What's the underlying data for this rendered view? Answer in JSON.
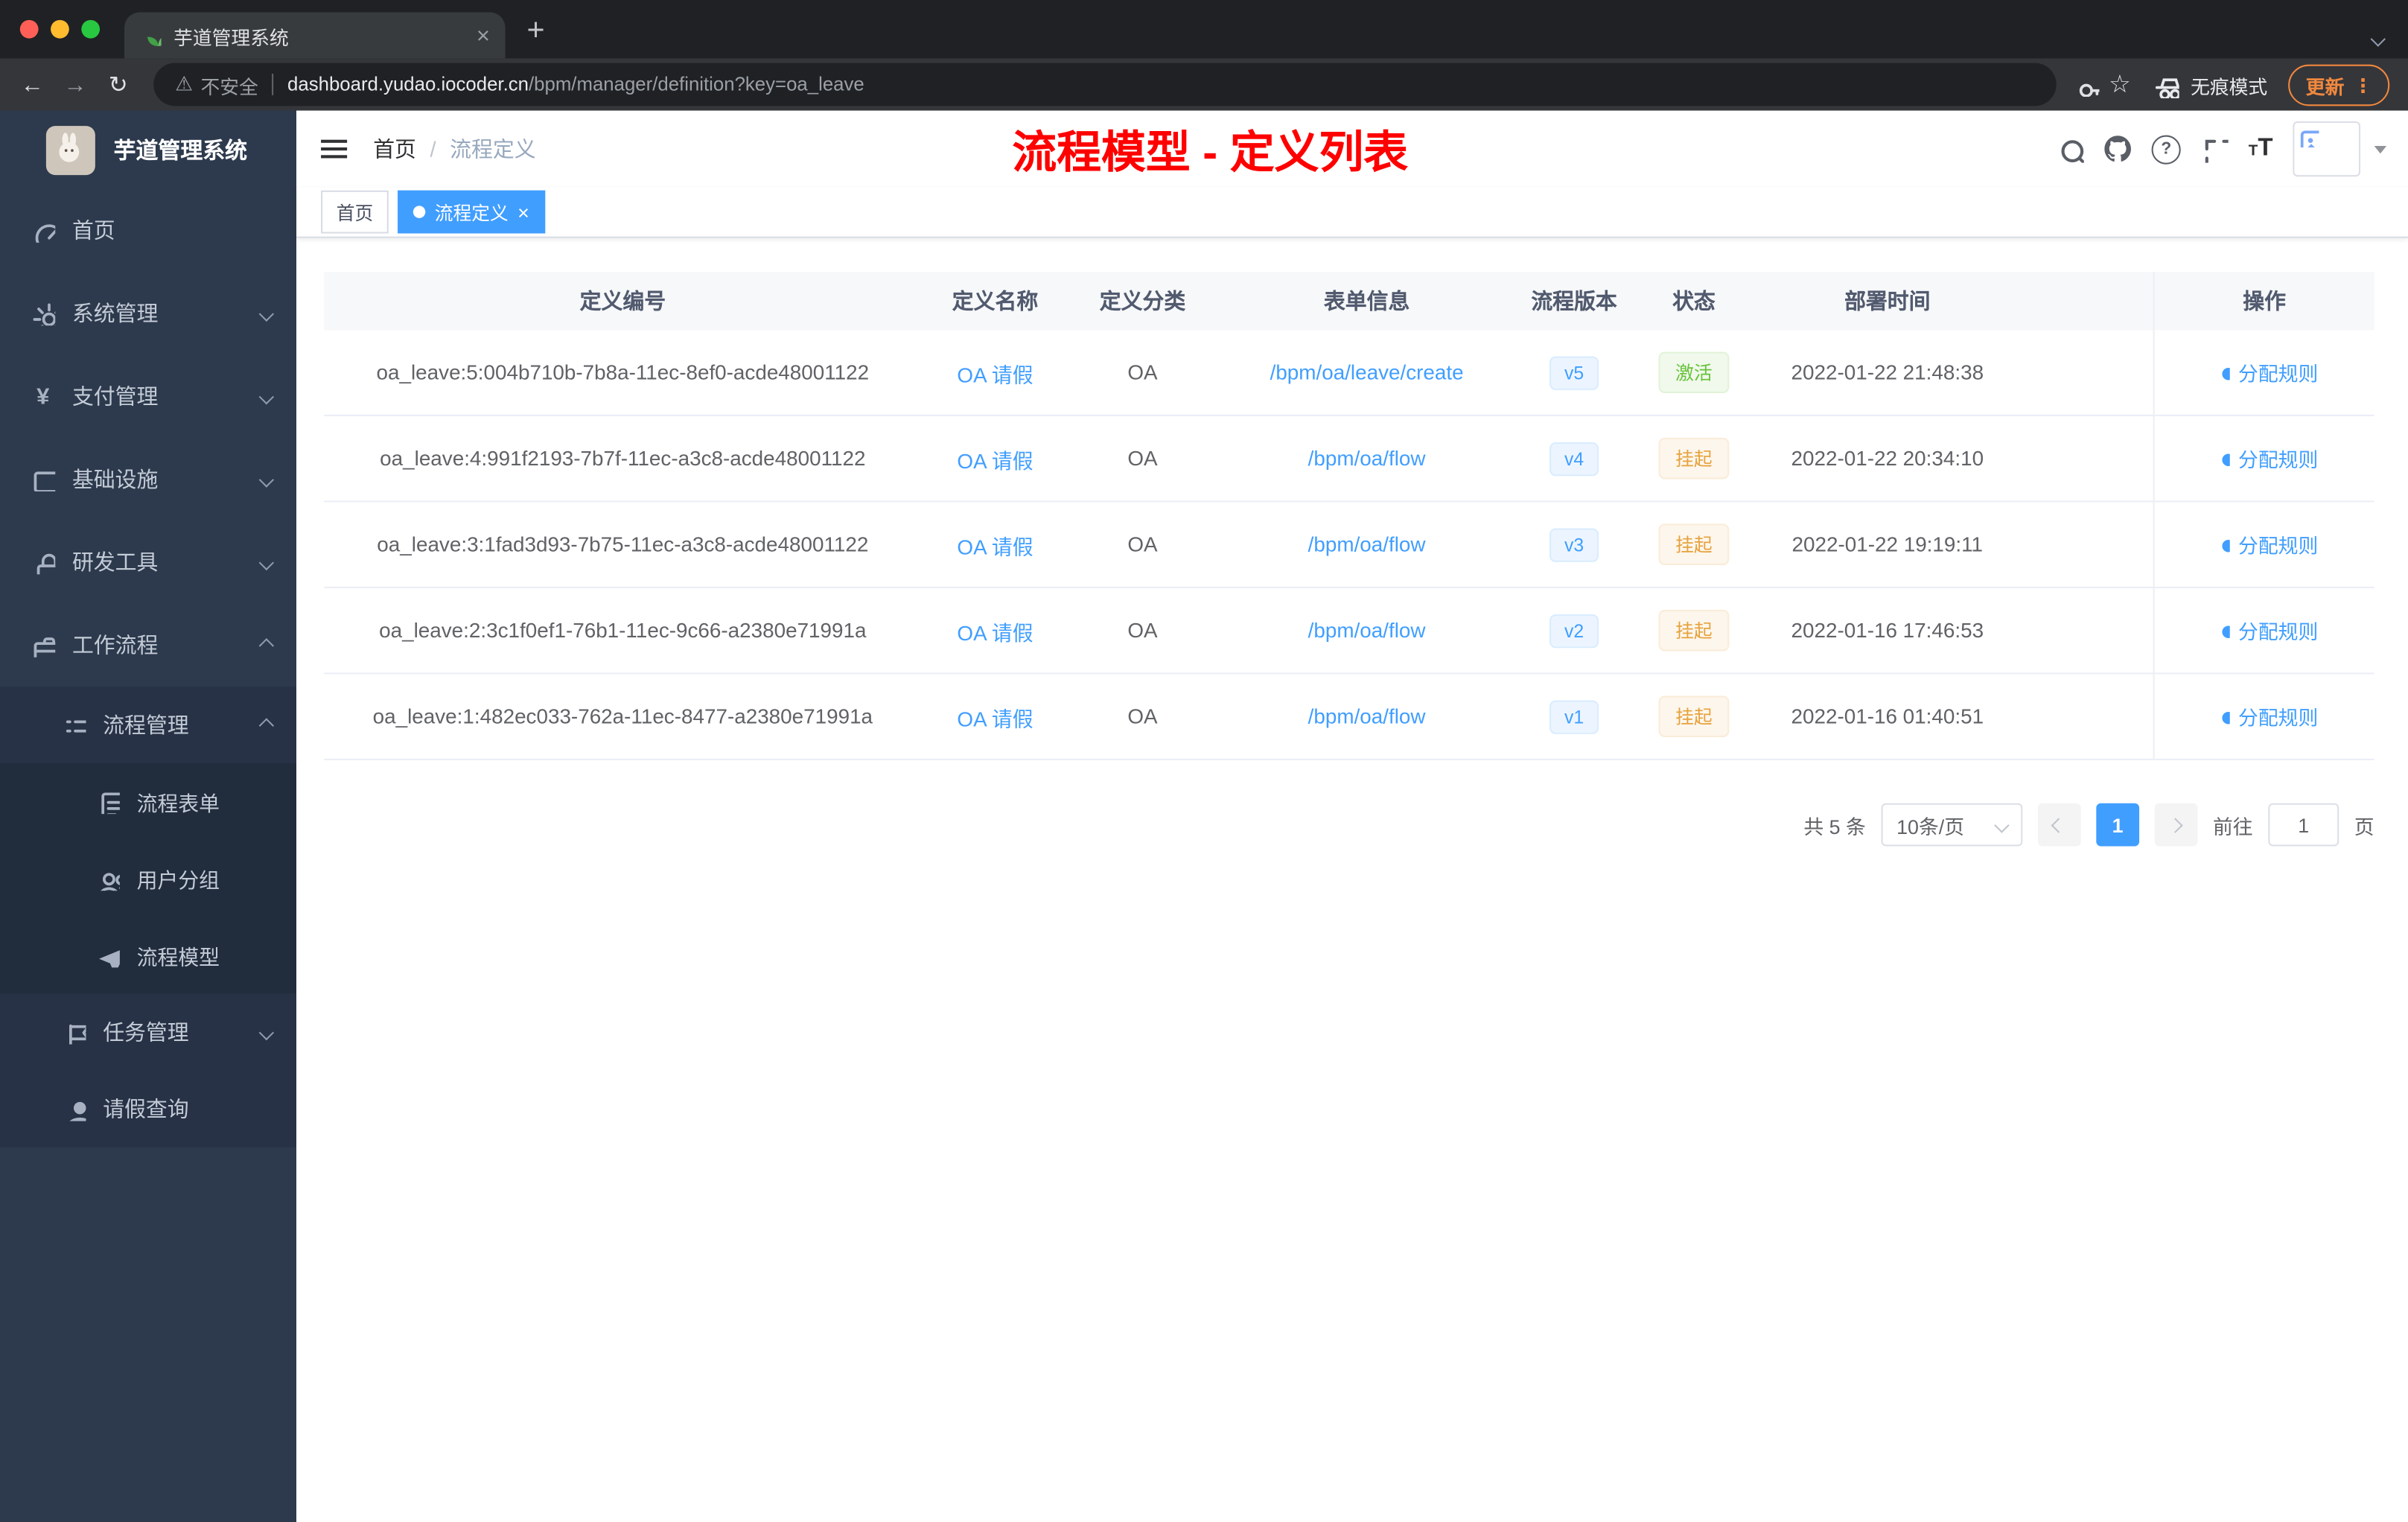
{
  "browser": {
    "tab_title": "芋道管理系统",
    "security_label": "不安全",
    "url_host": "dashboard.yudao.iocoder.cn",
    "url_path": "/bpm/manager/definition?key=oa_leave",
    "incognito_label": "无痕模式",
    "update_label": "更新"
  },
  "sidebar": {
    "logo_title": "芋道管理系统",
    "items": [
      {
        "label": "首页",
        "icon": "dashboard"
      },
      {
        "label": "系统管理",
        "icon": "gear"
      },
      {
        "label": "支付管理",
        "icon": "yen"
      },
      {
        "label": "基础设施",
        "icon": "monitor"
      },
      {
        "label": "研发工具",
        "icon": "lock"
      },
      {
        "label": "工作流程",
        "icon": "briefcase"
      },
      {
        "label": "流程管理",
        "icon": "list"
      },
      {
        "label": "流程表单",
        "icon": "document"
      },
      {
        "label": "用户分组",
        "icon": "users"
      },
      {
        "label": "流程模型",
        "icon": "paper-plane"
      },
      {
        "label": "任务管理",
        "icon": "flag"
      },
      {
        "label": "请假查询",
        "icon": "person"
      }
    ]
  },
  "header": {
    "breadcrumb_home": "首页",
    "breadcrumb_separator": "/",
    "breadcrumb_current": "流程定义",
    "annotation": "流程模型 - 定义列表"
  },
  "tags": {
    "home": "首页",
    "active": "流程定义"
  },
  "table": {
    "columns": [
      "定义编号",
      "定义名称",
      "定义分类",
      "表单信息",
      "流程版本",
      "状态",
      "部署时间",
      "操作"
    ],
    "action_label": "分配规则",
    "rows": [
      {
        "id": "oa_leave:5:004b710b-7b8a-11ec-8ef0-acde48001122",
        "name": "OA 请假",
        "category": "OA",
        "form": "/bpm/oa/leave/create",
        "version": "v5",
        "status": "激活",
        "time": "2022-01-22 21:48:38"
      },
      {
        "id": "oa_leave:4:991f2193-7b7f-11ec-a3c8-acde48001122",
        "name": "OA 请假",
        "category": "OA",
        "form": "/bpm/oa/flow",
        "version": "v4",
        "status": "挂起",
        "time": "2022-01-22 20:34:10"
      },
      {
        "id": "oa_leave:3:1fad3d93-7b75-11ec-a3c8-acde48001122",
        "name": "OA 请假",
        "category": "OA",
        "form": "/bpm/oa/flow",
        "version": "v3",
        "status": "挂起",
        "time": "2022-01-22 19:19:11"
      },
      {
        "id": "oa_leave:2:3c1f0ef1-76b1-11ec-9c66-a2380e71991a",
        "name": "OA 请假",
        "category": "OA",
        "form": "/bpm/oa/flow",
        "version": "v2",
        "status": "挂起",
        "time": "2022-01-16 17:46:53"
      },
      {
        "id": "oa_leave:1:482ec033-762a-11ec-8477-a2380e71991a",
        "name": "OA 请假",
        "category": "OA",
        "form": "/bpm/oa/flow",
        "version": "v1",
        "status": "挂起",
        "time": "2022-01-16 01:40:51"
      }
    ]
  },
  "pagination": {
    "total": "共 5 条",
    "page_size": "10条/页",
    "page": "1",
    "goto_label": "前往",
    "goto_value": "1",
    "unit_label": "页"
  },
  "colors": {
    "accent": "#409eff",
    "success": "#67c23a",
    "warning": "#e6a23c",
    "annotation": "#fe0000",
    "sidebar_bg": "#2d3a4d"
  }
}
